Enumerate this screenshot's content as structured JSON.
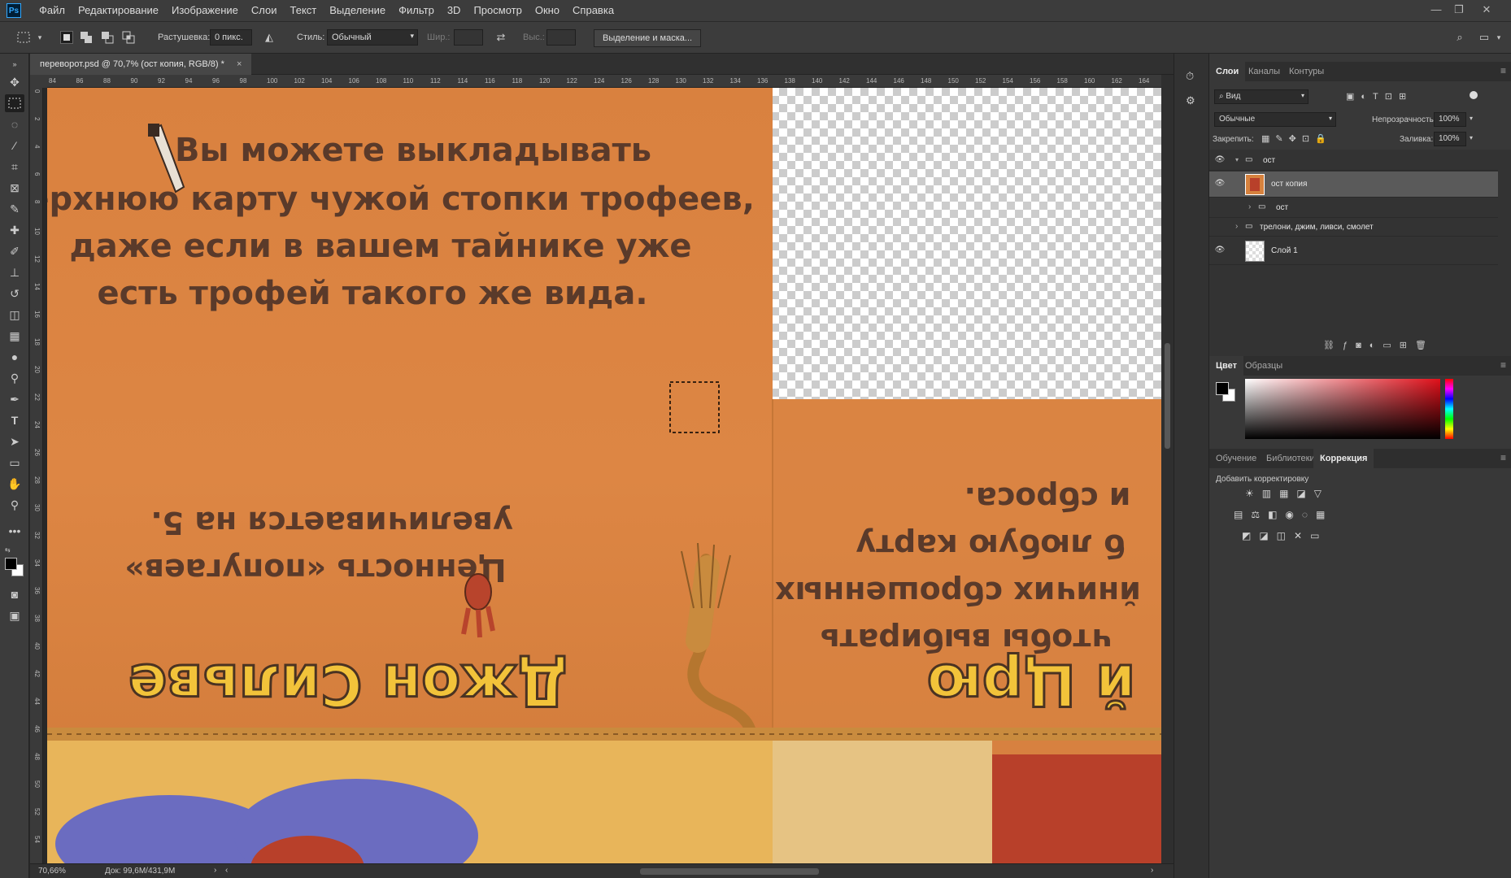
{
  "app": {
    "logo": "Ps",
    "menu": [
      "Файл",
      "Редактирование",
      "Изображение",
      "Слои",
      "Текст",
      "Выделение",
      "Фильтр",
      "3D",
      "Просмотр",
      "Окно",
      "Справка"
    ]
  },
  "options": {
    "feather_label": "Растушевка:",
    "feather_value": "0 пикс.",
    "style_label": "Стиль:",
    "style_value": "Обычный",
    "width_label": "Шир.:",
    "height_label": "Выс.:",
    "mask_button": "Выделение и маска..."
  },
  "document": {
    "tab_title": "переворот.psd @ 70,7% (ост копия, RGB/8) *",
    "close": "×",
    "ruler_h": [
      "84",
      "86",
      "88",
      "90",
      "92",
      "94",
      "96",
      "98",
      "100",
      "102",
      "104",
      "106",
      "108",
      "110",
      "112",
      "114",
      "116",
      "118",
      "120",
      "122",
      "124",
      "126",
      "128",
      "130",
      "132",
      "134",
      "136",
      "138",
      "140",
      "142",
      "144",
      "146",
      "148",
      "150",
      "152",
      "154",
      "156",
      "158",
      "160",
      "162",
      "164"
    ],
    "ruler_v": [
      "0",
      "2",
      "4",
      "6",
      "8",
      "10",
      "12",
      "14",
      "16",
      "18",
      "20",
      "22",
      "24",
      "26",
      "28",
      "30",
      "32",
      "34",
      "36",
      "38",
      "40",
      "42",
      "44",
      "46",
      "48",
      "50",
      "52",
      "54"
    ],
    "artwork": {
      "upright_text": [
        "Вы можете выкладывать",
        "верхнюю карту чужой стопки трофеев,",
        "даже если в вашем тайнике уже",
        "есть трофей такого же вида."
      ],
      "flipped_left": [
        "Ценность «попугаев»",
        "увеличивается на 5."
      ],
      "flipped_right": [
        "и сброса.",
        "б любую карту",
        "йничих сброшенных",
        "чтобы выбирать"
      ],
      "banner_left": "Джон Сильве",
      "banner_right": "й Црю"
    },
    "zoom": "70,66%",
    "doc_size": "Док: 99,6M/431,9M"
  },
  "layers_panel": {
    "tabs": [
      "Слои",
      "Каналы",
      "Контуры"
    ],
    "filter": "Вид",
    "blend_mode": "Обычные",
    "opacity_label": "Непрозрачность:",
    "opacity_value": "100%",
    "lock_label": "Закрепить:",
    "fill_label": "Заливка:",
    "fill_value": "100%",
    "layers": [
      "ост",
      "ост копия",
      "ост",
      "трелони, джим, ливси, смолет",
      "Слой 1"
    ]
  },
  "color_panel": {
    "tabs": [
      "Цвет",
      "Образцы"
    ],
    "foreground": "#000000",
    "background": "#ffffff"
  },
  "adjust_panel": {
    "tabs": [
      "Обучение",
      "Библиотеки",
      "Коррекция"
    ],
    "add_label": "Добавить корректировку"
  },
  "colors": {
    "canvas_orange": "#d6823e",
    "banner_yellow": "#f2c33a",
    "text_dark": "#5a3a2a"
  }
}
